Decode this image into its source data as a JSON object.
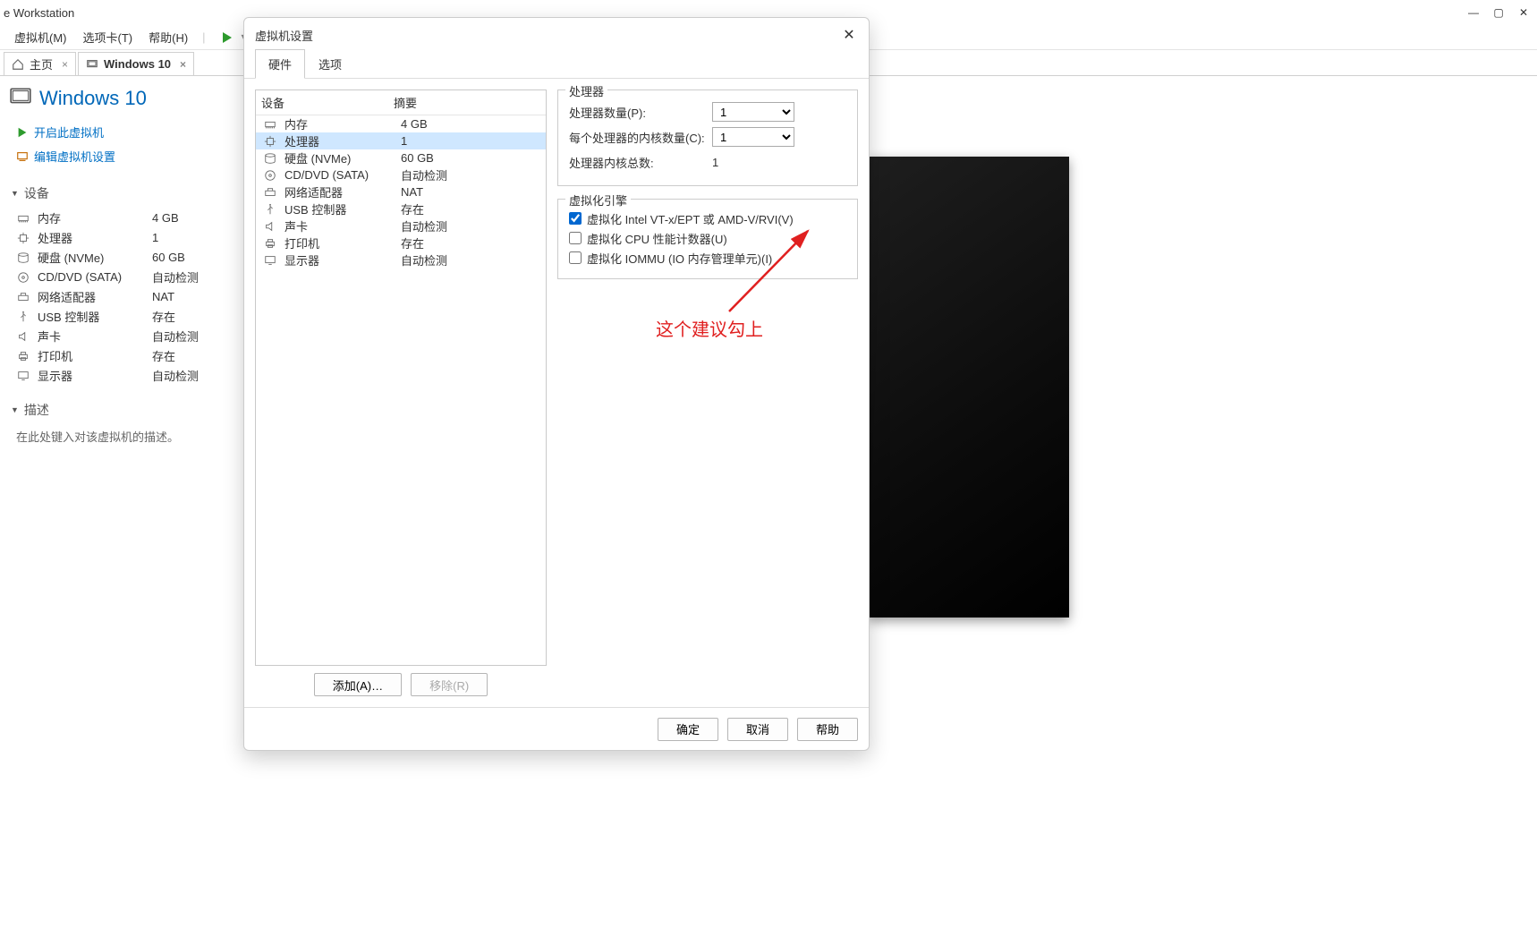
{
  "titlebar": {
    "title": "e Workstation"
  },
  "menubar": {
    "vm": "虚拟机(M)",
    "tabs": "选项卡(T)",
    "help": "帮助(H)"
  },
  "tabs": {
    "home": "主页",
    "vm": "Windows 10"
  },
  "vm": {
    "name": "Windows 10",
    "actions": {
      "power_on": "开启此虚拟机",
      "edit": "编辑虚拟机设置"
    }
  },
  "sections": {
    "devices": "设备",
    "description": "描述"
  },
  "devices": [
    {
      "icon": "memory",
      "name": "内存",
      "value": "4 GB"
    },
    {
      "icon": "cpu",
      "name": "处理器",
      "value": "1"
    },
    {
      "icon": "disk",
      "name": "硬盘 (NVMe)",
      "value": "60 GB"
    },
    {
      "icon": "disc",
      "name": "CD/DVD (SATA)",
      "value": "自动检测"
    },
    {
      "icon": "net",
      "name": "网络适配器",
      "value": "NAT"
    },
    {
      "icon": "usb",
      "name": "USB 控制器",
      "value": "存在"
    },
    {
      "icon": "sound",
      "name": "声卡",
      "value": "自动检测"
    },
    {
      "icon": "printer",
      "name": "打印机",
      "value": "存在"
    },
    {
      "icon": "display",
      "name": "显示器",
      "value": "自动检测"
    }
  ],
  "description_placeholder": "在此处键入对该虚拟机的描述。",
  "dialog": {
    "title": "虚拟机设置",
    "tab_hardware": "硬件",
    "tab_options": "选项",
    "hw_header": {
      "device": "设备",
      "summary": "摘要"
    },
    "hw_rows": [
      {
        "icon": "memory",
        "name": "内存",
        "value": "4 GB"
      },
      {
        "icon": "cpu",
        "name": "处理器",
        "value": "1",
        "selected": true
      },
      {
        "icon": "disk",
        "name": "硬盘 (NVMe)",
        "value": "60 GB"
      },
      {
        "icon": "disc",
        "name": "CD/DVD (SATA)",
        "value": "自动检测"
      },
      {
        "icon": "net",
        "name": "网络适配器",
        "value": "NAT"
      },
      {
        "icon": "usb",
        "name": "USB 控制器",
        "value": "存在"
      },
      {
        "icon": "sound",
        "name": "声卡",
        "value": "自动检测"
      },
      {
        "icon": "printer",
        "name": "打印机",
        "value": "存在"
      },
      {
        "icon": "display",
        "name": "显示器",
        "value": "自动检测"
      }
    ],
    "add_btn": "添加(A)…",
    "remove_btn": "移除(R)",
    "cpu_group": {
      "legend": "处理器",
      "num_cpus_label": "处理器数量(P):",
      "num_cpus": "1",
      "cores_label": "每个处理器的内核数量(C):",
      "cores": "1",
      "total_label": "处理器内核总数:",
      "total": "1"
    },
    "virt_group": {
      "legend": "虚拟化引擎",
      "vtx": "虚拟化 Intel VT-x/EPT 或 AMD-V/RVI(V)",
      "perf": "虚拟化 CPU 性能计数器(U)",
      "iommu": "虚拟化 IOMMU (IO 内存管理单元)(I)"
    },
    "annotation": "这个建议勾上",
    "ok": "确定",
    "cancel": "取消",
    "help": "帮助"
  }
}
